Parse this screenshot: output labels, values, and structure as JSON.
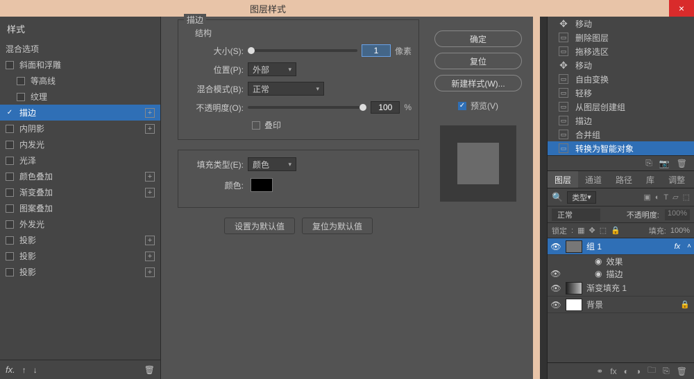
{
  "dialog": {
    "title": "图层样式",
    "leftHeader": "样式",
    "blendOptions": "混合选项",
    "leftFooter_fx": "fx.",
    "effects": [
      {
        "label": "斜面和浮雕",
        "checked": false,
        "plus": false,
        "indent": false
      },
      {
        "label": "等高线",
        "checked": false,
        "plus": false,
        "indent": true
      },
      {
        "label": "纹理",
        "checked": false,
        "plus": false,
        "indent": true
      },
      {
        "label": "描边",
        "checked": true,
        "plus": true,
        "indent": false,
        "selected": true
      },
      {
        "label": "内阴影",
        "checked": false,
        "plus": true,
        "indent": false
      },
      {
        "label": "内发光",
        "checked": false,
        "plus": false,
        "indent": false
      },
      {
        "label": "光泽",
        "checked": false,
        "plus": false,
        "indent": false
      },
      {
        "label": "颜色叠加",
        "checked": false,
        "plus": true,
        "indent": false
      },
      {
        "label": "渐变叠加",
        "checked": false,
        "plus": true,
        "indent": false
      },
      {
        "label": "图案叠加",
        "checked": false,
        "plus": false,
        "indent": false
      },
      {
        "label": "外发光",
        "checked": false,
        "plus": false,
        "indent": false
      },
      {
        "label": "投影",
        "checked": false,
        "plus": true,
        "indent": false
      },
      {
        "label": "投影",
        "checked": false,
        "plus": true,
        "indent": false
      },
      {
        "label": "投影",
        "checked": false,
        "plus": true,
        "indent": false
      }
    ],
    "section_stroke": "描边",
    "structure_label": "结构",
    "size_label": "大小(S):",
    "size_value": "1",
    "size_unit": "像素",
    "position_label": "位置(P):",
    "position_value": "外部",
    "blendmode_label": "混合模式(B):",
    "blendmode_value": "正常",
    "opacity_label": "不透明度(O):",
    "opacity_value": "100",
    "opacity_unit": "%",
    "overprint_label": "叠印",
    "filltype_label": "填充类型(E):",
    "filltype_value": "颜色",
    "color_label": "颜色:",
    "btn_setdefault": "设置为默认值",
    "btn_resetdefault": "复位为默认值",
    "btn_ok": "确定",
    "btn_reset": "复位",
    "btn_newstyle": "新建样式(W)...",
    "preview_label": "预览(V)"
  },
  "history": {
    "items": [
      {
        "icon": "move",
        "label": "移动"
      },
      {
        "icon": "doc",
        "label": "删除图层"
      },
      {
        "icon": "doc",
        "label": "拖移选区"
      },
      {
        "icon": "move",
        "label": "移动"
      },
      {
        "icon": "doc",
        "label": "自由变换"
      },
      {
        "icon": "doc",
        "label": "轻移"
      },
      {
        "icon": "doc",
        "label": "从图层创建组"
      },
      {
        "icon": "doc",
        "label": "描边"
      },
      {
        "icon": "doc",
        "label": "合并组"
      },
      {
        "icon": "doc",
        "label": "转换为智能对象",
        "selected": true
      }
    ]
  },
  "layersPanel": {
    "tabs": [
      "图层",
      "通道",
      "路径",
      "库",
      "调整"
    ],
    "activeTab": 0,
    "filterType": "类型",
    "blendMode": "正常",
    "opacityLabel": "不透明度:",
    "opacityValue": "100%",
    "lockLabel": "锁定",
    "fillLabel": "填充:",
    "fillValue": "100%",
    "layers": [
      {
        "name": "组 1",
        "thumb": "group",
        "fx": true,
        "selected": true
      },
      {
        "name": "效果",
        "sub": true
      },
      {
        "name": "描边",
        "sub": true,
        "eye": true
      },
      {
        "name": "渐变填充 1",
        "thumb": "grad"
      },
      {
        "name": "背景",
        "thumb": "white",
        "locked": true
      }
    ]
  }
}
